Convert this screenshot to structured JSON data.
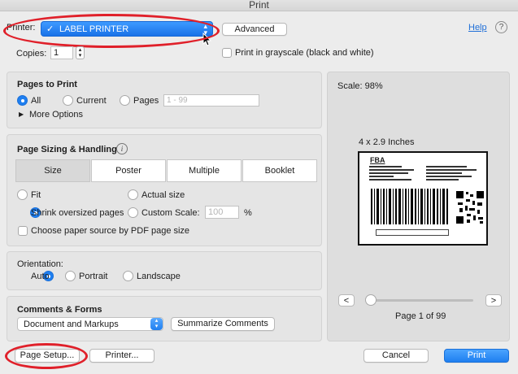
{
  "window": {
    "title": "Print"
  },
  "printer": {
    "label": "Printer:",
    "selected": "LABEL PRINTER",
    "advanced_label": "Advanced",
    "help_label": "Help"
  },
  "copies": {
    "label": "Copies:",
    "value": "1",
    "grayscale_label": "Print in grayscale (black and white)"
  },
  "pages_to_print": {
    "title": "Pages to Print",
    "all_label": "All",
    "current_label": "Current",
    "pages_label": "Pages",
    "pages_placeholder": "1 - 99",
    "more_options_label": "More Options",
    "selected": "All"
  },
  "sizing": {
    "title": "Page Sizing & Handling",
    "tabs": [
      "Size",
      "Poster",
      "Multiple",
      "Booklet"
    ],
    "active_tab": "Size",
    "fit_label": "Fit",
    "actual_size_label": "Actual size",
    "shrink_label": "Shrink oversized pages",
    "custom_scale_label": "Custom Scale:",
    "custom_scale_placeholder": "100",
    "percent": "%",
    "choose_source_label": "Choose paper source by PDF page size",
    "selected": "Shrink oversized pages"
  },
  "orientation": {
    "title": "Orientation:",
    "auto_label": "Auto",
    "portrait_label": "Portrait",
    "landscape_label": "Landscape",
    "selected": "Auto"
  },
  "comments": {
    "title": "Comments & Forms",
    "selected": "Document and Markups",
    "summarize_label": "Summarize Comments"
  },
  "preview": {
    "scale_label": "Scale:",
    "scale_value": "98%",
    "size_label": "4 x 2.9 Inches",
    "label_heading": "FBA",
    "page_info": "Page 1 of 99",
    "prev_symbol": "<",
    "next_symbol": ">",
    "slider_fraction": 0.0
  },
  "footer": {
    "page_setup_label": "Page Setup...",
    "printer_label": "Printer...",
    "cancel_label": "Cancel",
    "print_label": "Print"
  },
  "colors": {
    "accent": "#1f7ff0",
    "highlight_circle": "#e0202a"
  },
  "icons": {
    "help": "question-circle-icon",
    "info": "info-circle-icon",
    "disclosure": "triangle-right-icon",
    "dropdown": "chevron-updown-icon",
    "cursor": "mouse-pointer-icon"
  }
}
